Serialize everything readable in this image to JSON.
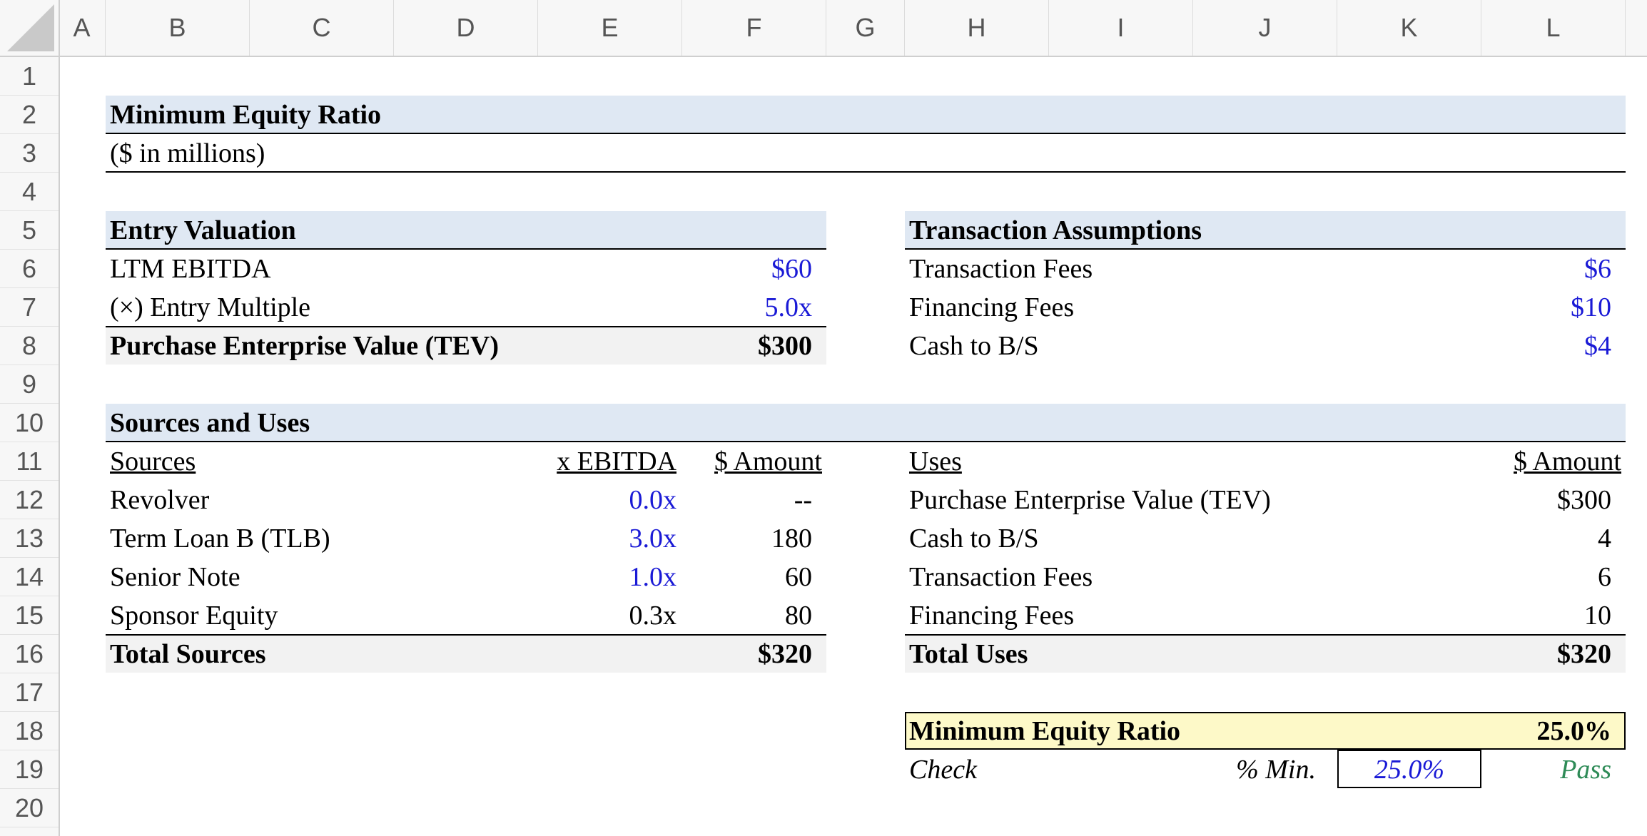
{
  "columns": [
    "A",
    "B",
    "C",
    "D",
    "E",
    "F",
    "G",
    "H",
    "I",
    "J",
    "K",
    "L"
  ],
  "rows": [
    "1",
    "2",
    "3",
    "4",
    "5",
    "6",
    "7",
    "8",
    "9",
    "10",
    "11",
    "12",
    "13",
    "14",
    "15",
    "16",
    "17",
    "18",
    "19",
    "20"
  ],
  "title": "Minimum Equity Ratio",
  "subtitle": "($ in millions)",
  "entry": {
    "header": "Entry Valuation",
    "ltm_label": "LTM EBITDA",
    "ltm_value": "$60",
    "mult_label": "(×) Entry Multiple",
    "mult_value": "5.0x",
    "tev_label": "Purchase Enterprise Value (TEV)",
    "tev_value": "$300"
  },
  "assumptions": {
    "header": "Transaction Assumptions",
    "items": [
      {
        "label": "Transaction Fees",
        "value": "$6"
      },
      {
        "label": "Financing Fees",
        "value": "$10"
      },
      {
        "label": "Cash to B/S",
        "value": "$4"
      }
    ]
  },
  "su": {
    "header": "Sources and Uses",
    "sources_hdr": "Sources",
    "ebitda_hdr": "x EBITDA",
    "amount_hdr": "$ Amount",
    "sources": [
      {
        "label": "Revolver",
        "mult": "0.0x",
        "amount": "--"
      },
      {
        "label": "Term Loan B (TLB)",
        "mult": "3.0x",
        "amount": "180"
      },
      {
        "label": "Senior Note",
        "mult": "1.0x",
        "amount": "60"
      },
      {
        "label": "Sponsor Equity",
        "mult": "0.3x",
        "amount": "80"
      }
    ],
    "total_sources_label": "Total Sources",
    "total_sources_value": "$320",
    "uses_hdr": "Uses",
    "uses_amount_hdr": "$ Amount",
    "uses": [
      {
        "label": "Purchase Enterprise Value (TEV)",
        "amount": "$300"
      },
      {
        "label": "Cash to B/S",
        "amount": "4"
      },
      {
        "label": "Transaction Fees",
        "amount": "6"
      },
      {
        "label": "Financing Fees",
        "amount": "10"
      }
    ],
    "total_uses_label": "Total Uses",
    "total_uses_value": "$320"
  },
  "ratio": {
    "label": "Minimum Equity Ratio",
    "value": "25.0%",
    "check_label": "Check",
    "min_label": "% Min.",
    "min_value": "25.0%",
    "result": "Pass"
  },
  "colors": {
    "header_band": "#dfe8f3",
    "total_band": "#f2f2f2",
    "input_blue": "#1a1ad6",
    "pass_green": "#2e8b57",
    "highlight_yellow": "#fdf9c8"
  }
}
